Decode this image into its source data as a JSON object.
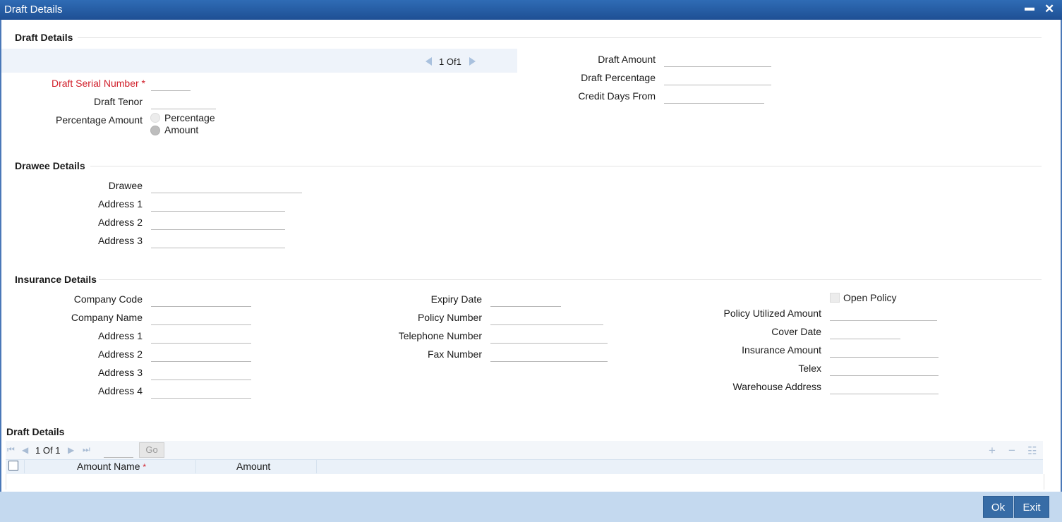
{
  "window": {
    "title": "Draft Details",
    "minimize_glyph": "▬",
    "close_glyph": "✕"
  },
  "draft": {
    "section_title": "Draft Details",
    "nav": {
      "page": "1",
      "of_label": "Of",
      "total": "1"
    },
    "serial_number": {
      "label": "Draft Serial Number",
      "required": "*",
      "value": ""
    },
    "tenor": {
      "label": "Draft Tenor",
      "value": ""
    },
    "percentage_amount": {
      "label": "Percentage Amount",
      "options": [
        "Percentage",
        "Amount"
      ],
      "selected": "Amount"
    },
    "amount": {
      "label": "Draft Amount",
      "value": ""
    },
    "percentage": {
      "label": "Draft Percentage",
      "value": ""
    },
    "credit_days_from": {
      "label": "Credit Days From",
      "value": ""
    }
  },
  "drawee": {
    "section_title": "Drawee Details",
    "drawee": {
      "label": "Drawee",
      "value": ""
    },
    "address1": {
      "label": "Address 1",
      "value": ""
    },
    "address2": {
      "label": "Address 2",
      "value": ""
    },
    "address3": {
      "label": "Address 3",
      "value": ""
    }
  },
  "insurance": {
    "section_title": "Insurance Details",
    "company_code": {
      "label": "Company Code",
      "value": ""
    },
    "company_name": {
      "label": "Company Name",
      "value": ""
    },
    "address1": {
      "label": "Address 1",
      "value": ""
    },
    "address2": {
      "label": "Address 2",
      "value": ""
    },
    "address3": {
      "label": "Address 3",
      "value": ""
    },
    "address4": {
      "label": "Address 4",
      "value": ""
    },
    "expiry_date": {
      "label": "Expiry Date",
      "value": ""
    },
    "policy_number": {
      "label": "Policy Number",
      "value": ""
    },
    "telephone_number": {
      "label": "Telephone Number",
      "value": ""
    },
    "fax_number": {
      "label": "Fax Number",
      "value": ""
    },
    "open_policy": {
      "label": "Open Policy",
      "checked": false
    },
    "policy_utilized_amount": {
      "label": "Policy Utilized Amount",
      "value": ""
    },
    "cover_date": {
      "label": "Cover Date",
      "value": ""
    },
    "insurance_amount": {
      "label": "Insurance Amount",
      "value": ""
    },
    "telex": {
      "label": "Telex",
      "value": ""
    },
    "warehouse_address": {
      "label": "Warehouse Address",
      "value": ""
    }
  },
  "grid": {
    "section_title": "Draft Details",
    "nav": {
      "page": "1",
      "of_label": "Of",
      "total": "1",
      "page_input": "",
      "go_label": "Go"
    },
    "icons": {
      "first": "⏮",
      "prev": "◀",
      "next": "▶",
      "last": "⏭",
      "add": "+",
      "remove": "−",
      "view": "☷"
    },
    "columns": [
      {
        "label": "Amount Name",
        "required": "*"
      },
      {
        "label": "Amount",
        "required": ""
      }
    ]
  },
  "footer": {
    "ok_label": "Ok",
    "exit_label": "Exit"
  },
  "colors": {
    "title_bar": "#2f6cb5",
    "required": "#d1202b",
    "button": "#376ca6",
    "footer": "#c4d9ef"
  }
}
